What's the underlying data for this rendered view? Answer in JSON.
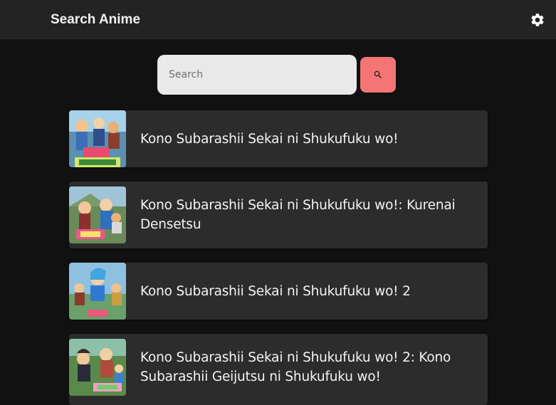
{
  "header": {
    "title": "Search Anime",
    "settings_icon": "gear-icon"
  },
  "search": {
    "placeholder": "Search",
    "value": "",
    "button_icon": "search-icon",
    "button_color": "#f37575"
  },
  "results": [
    {
      "title": "Kono Subarashii Sekai ni Shukufuku wo!"
    },
    {
      "title": "Kono Subarashii Sekai ni Shukufuku wo!: Kurenai Densetsu"
    },
    {
      "title": "Kono Subarashii Sekai ni Shukufuku wo! 2"
    },
    {
      "title": "Kono Subarashii Sekai ni Shukufuku wo! 2: Kono Subarashii Geijutsu ni Shukufuku wo!"
    }
  ]
}
